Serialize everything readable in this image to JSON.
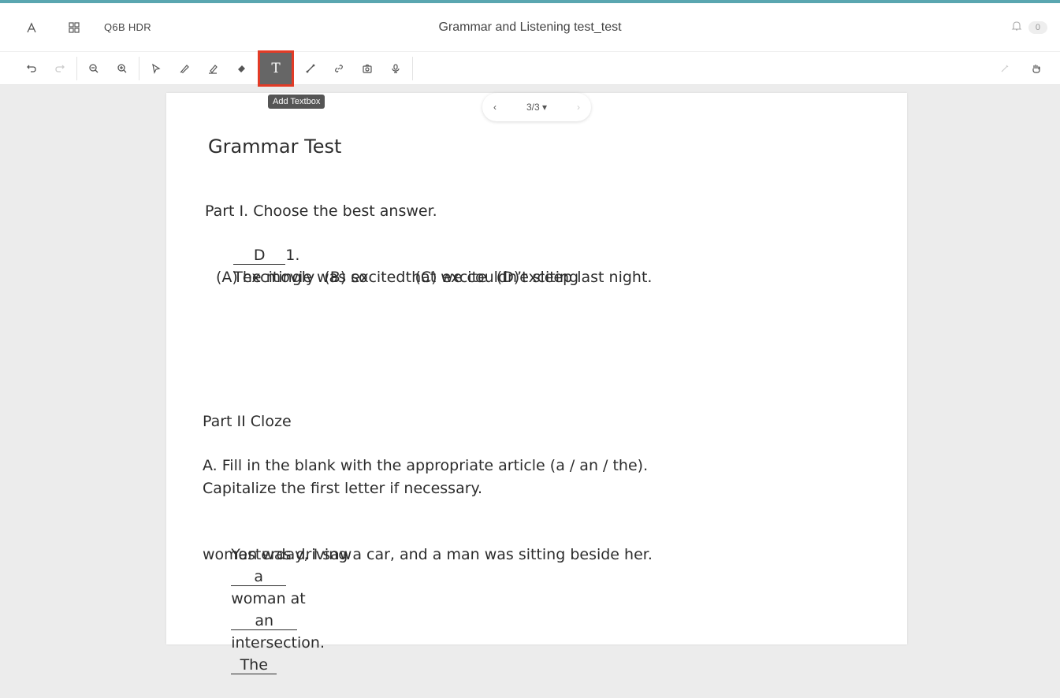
{
  "header": {
    "class_name": "Q6B HDR",
    "title": "Grammar and Listening test_test",
    "notification_count": "0"
  },
  "toolbar": {
    "tooltip": "Add Textbox",
    "textbox_label": "T"
  },
  "pager": {
    "prev": "‹",
    "current": "3/3",
    "caret": "▾",
    "next": "›"
  },
  "document": {
    "heading": "Grammar Test",
    "part1_title": "Part I. Choose the best answer.",
    "q1_answer": "D",
    "q1_number": "1.",
    "q1_stem_a": "The movie was so",
    "q1_stem_b": "that we couldn’t sleep last night.",
    "q1_options": "(A) excitingly  (B) excited  (C) excite  (D)exciting",
    "part2_title": "Part II Cloze",
    "instructions_line1": "A. Fill in the blank with the appropriate article (a / an / the).",
    "instructions_line2": "Capitalize the first letter if necessary.",
    "cloze_a": "Yesterday, I saw",
    "cloze_blank1": "a",
    "cloze_b": "woman at",
    "cloze_blank2": "an",
    "cloze_c": "intersection.",
    "cloze_blank3": "The",
    "cloze_line2": "woman was driving a car, and a man was sitting beside her."
  }
}
